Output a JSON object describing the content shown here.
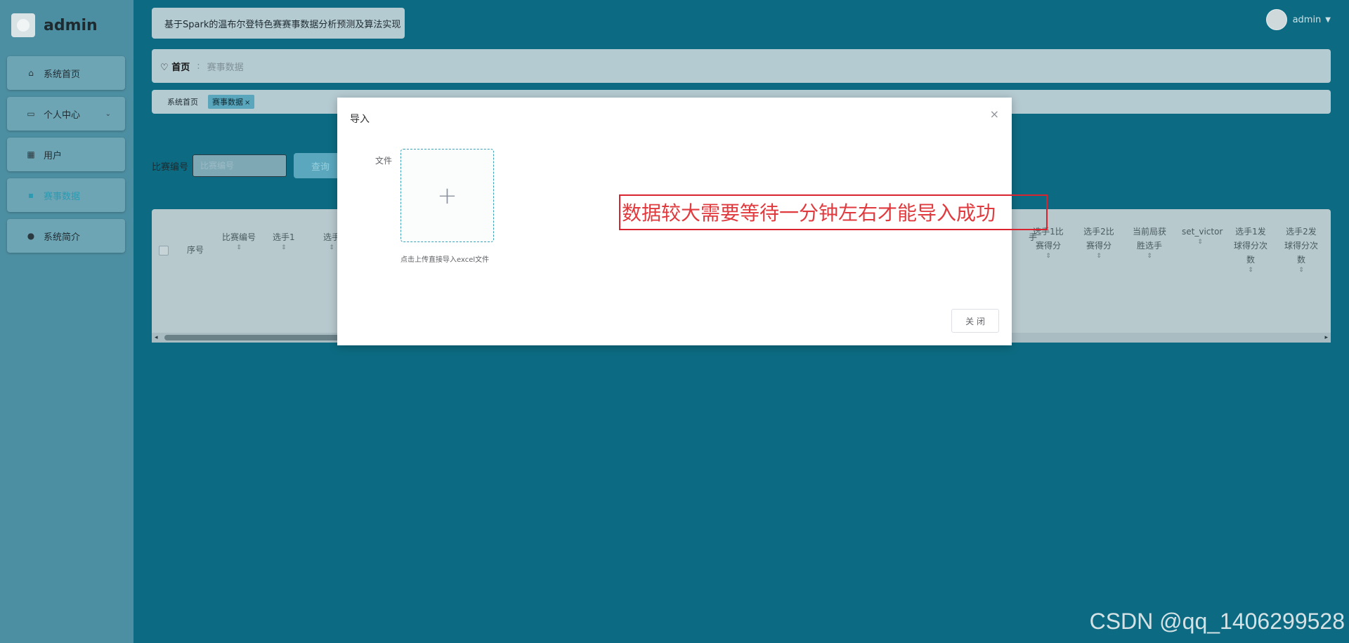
{
  "sidebar": {
    "brand": "admin",
    "items": [
      {
        "label": "系统首页",
        "icon": "home-icon"
      },
      {
        "label": "个人中心",
        "icon": "profile-icon"
      },
      {
        "label": "用户",
        "icon": "grid-icon"
      },
      {
        "label": "赛事数据",
        "icon": "monitor-icon"
      },
      {
        "label": "系统简介",
        "icon": "person-icon"
      }
    ]
  },
  "header": {
    "title": "基于Spark的温布尔登特色赛赛事数据分析预测及算法实现",
    "user": "admin"
  },
  "breadcrumb": {
    "home": "首页",
    "current": "赛事数据"
  },
  "tabs": [
    {
      "label": "系统首页"
    },
    {
      "label": "赛事数据",
      "close": "×"
    }
  ],
  "search": {
    "label": "比赛编号",
    "placeholder": "比赛编号",
    "button": "查询"
  },
  "table": {
    "headers_left": [
      "序号",
      "比赛编号",
      "选手1",
      "选手"
    ],
    "headers_right": [
      "手",
      "选手1比赛得分",
      "选手2比赛得分",
      "当前局获胜选手",
      "set_victor",
      "选手1发球得分次数",
      "选手2发球得分次数"
    ],
    "sort_glyph": "⇕"
  },
  "dialog": {
    "title": "导入",
    "close_glyph": "×",
    "file_label": "文件",
    "upload_plus": "+",
    "upload_tip": "点击上传直接导入excel文件",
    "close_button": "关 闭"
  },
  "annotation": {
    "text": "数据较大需要等待一分钟左右才能导入成功",
    "color": "#d9232e"
  },
  "watermark": "CSDN @qq_1406299528"
}
